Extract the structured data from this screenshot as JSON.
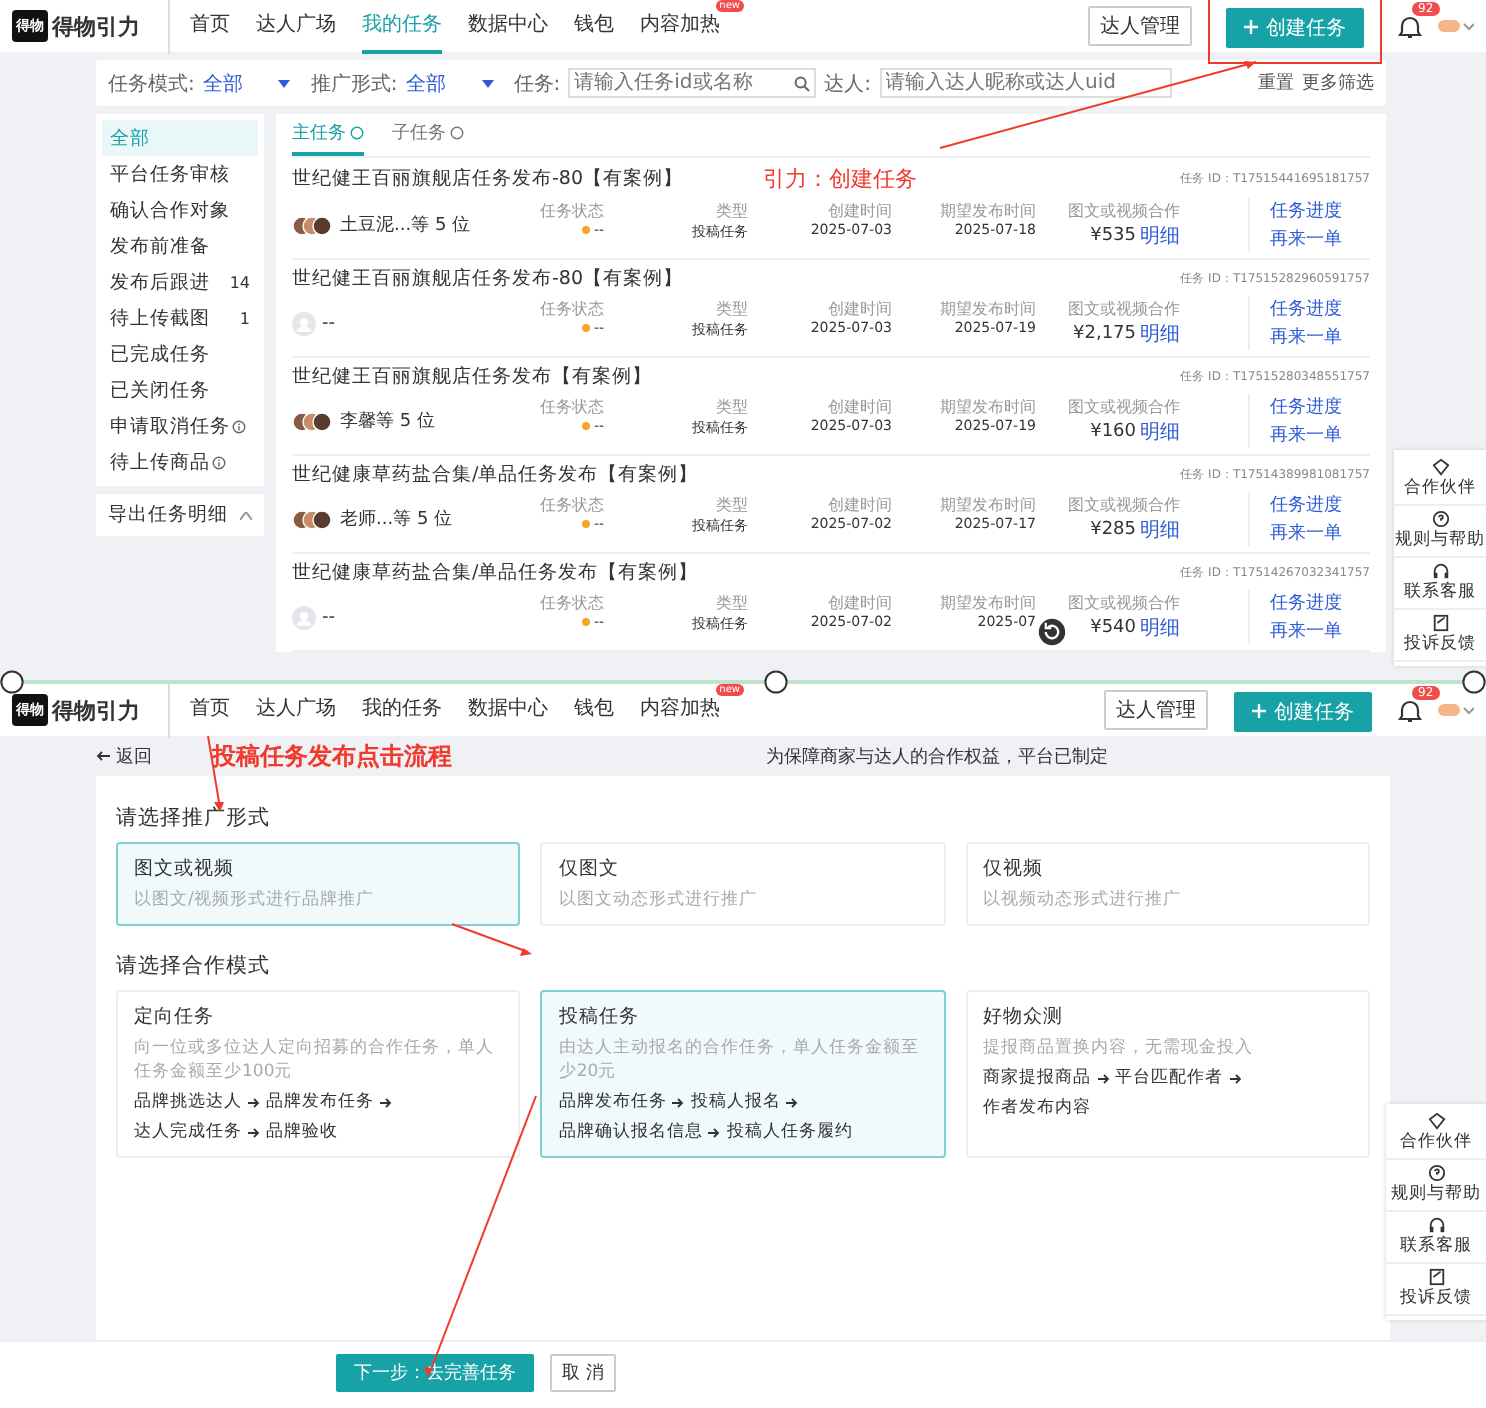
{
  "top": {
    "nav": {
      "logo_mark": "得物",
      "logo_text": "得物引力",
      "items": [
        {
          "label": "首页",
          "selected": false
        },
        {
          "label": "达人广场",
          "selected": false
        },
        {
          "label": "我的任务",
          "selected": true
        },
        {
          "label": "数据中心",
          "selected": false
        },
        {
          "label": "钱包",
          "selected": false
        },
        {
          "label": "内容加热",
          "selected": false,
          "badge": "new"
        }
      ],
      "manage": "达人管理",
      "create": "创建任务",
      "highlighted": true,
      "notifications": "92"
    },
    "filters": {
      "mode_label": "任务模式:",
      "mode_value": "全部",
      "form_label": "推广形式:",
      "form_value": "全部",
      "task_label": "任务:",
      "task_placeholder": "请输入任务id或名称",
      "talent_label": "达人:",
      "talent_placeholder": "请输入达人昵称或达人uid",
      "reset": "重置",
      "more": "更多筛选"
    },
    "sidebar": {
      "items": [
        {
          "label": "全部",
          "selected": true
        },
        {
          "label": "平台任务审核",
          "selected": false
        },
        {
          "label": "确认合作对象",
          "selected": false
        },
        {
          "label": "发布前准备",
          "selected": false
        },
        {
          "label": "发布后跟进",
          "selected": false,
          "count": "14"
        },
        {
          "label": "待上传截图",
          "selected": false,
          "count": "1"
        },
        {
          "label": "已完成任务",
          "selected": false
        },
        {
          "label": "已关闭任务",
          "selected": false
        },
        {
          "label": "申请取消任务",
          "selected": false,
          "info": true
        },
        {
          "label": "待上传商品",
          "selected": false,
          "info": true
        }
      ],
      "export": "导出任务明细"
    },
    "tabs": [
      {
        "label": "主任务",
        "selected": true
      },
      {
        "label": "子任务",
        "selected": false
      }
    ],
    "annotation": "引力：创建任务",
    "tasks": [
      {
        "title": "世纪健王百丽旗舰店任务发布-80【有案例】",
        "talents": "土豆泥...等 5 位",
        "avatars": true,
        "id": "任务 ID：T17515441695181757",
        "fields": [
          {
            "kind": "status",
            "label": "任务状态",
            "value": "--"
          },
          {
            "kind": "text",
            "label": "类型",
            "value": "投稿任务"
          },
          {
            "kind": "text",
            "label": "创建时间",
            "value": "2025-07-03"
          },
          {
            "kind": "text",
            "label": "期望发布时间",
            "value": "2025-07-18"
          },
          {
            "kind": "price",
            "label": "图文或视频合作",
            "value": "¥535",
            "link": "明细"
          }
        ],
        "actions": [
          "任务进度",
          "再来一单"
        ]
      },
      {
        "title": "世纪健王百丽旗舰店任务发布-80【有案例】",
        "talents": "--",
        "avatars": false,
        "id": "任务 ID：T17515282960591757",
        "fields": [
          {
            "kind": "status",
            "label": "任务状态",
            "value": "--"
          },
          {
            "kind": "text",
            "label": "类型",
            "value": "投稿任务"
          },
          {
            "kind": "text",
            "label": "创建时间",
            "value": "2025-07-03"
          },
          {
            "kind": "text",
            "label": "期望发布时间",
            "value": "2025-07-19"
          },
          {
            "kind": "price",
            "label": "图文或视频合作",
            "value": "¥2,175",
            "link": "明细"
          }
        ],
        "actions": [
          "任务进度",
          "再来一单"
        ]
      },
      {
        "title": "世纪健王百丽旗舰店任务发布【有案例】",
        "talents": "李馨等 5 位",
        "avatars": true,
        "id": "任务 ID：T17515280348551757",
        "fields": [
          {
            "kind": "status",
            "label": "任务状态",
            "value": "--"
          },
          {
            "kind": "text",
            "label": "类型",
            "value": "投稿任务"
          },
          {
            "kind": "text",
            "label": "创建时间",
            "value": "2025-07-03"
          },
          {
            "kind": "text",
            "label": "期望发布时间",
            "value": "2025-07-19"
          },
          {
            "kind": "price",
            "label": "图文或视频合作",
            "value": "¥160",
            "link": "明细"
          }
        ],
        "actions": [
          "任务进度",
          "再来一单"
        ]
      },
      {
        "title": "世纪健康草药盐合集/单品任务发布【有案例】",
        "talents": "老师...等 5 位",
        "avatars": true,
        "id": "任务 ID：T17514389981081757",
        "fields": [
          {
            "kind": "status",
            "label": "任务状态",
            "value": "--"
          },
          {
            "kind": "text",
            "label": "类型",
            "value": "投稿任务"
          },
          {
            "kind": "text",
            "label": "创建时间",
            "value": "2025-07-02"
          },
          {
            "kind": "text",
            "label": "期望发布时间",
            "value": "2025-07-17"
          },
          {
            "kind": "price",
            "label": "图文或视频合作",
            "value": "¥285",
            "link": "明细"
          }
        ],
        "actions": [
          "任务进度",
          "再来一单"
        ]
      },
      {
        "title": "世纪健康草药盐合集/单品任务发布【有案例】",
        "talents": "--",
        "avatars": false,
        "id": "任务 ID：T17514267032341757",
        "fields": [
          {
            "kind": "status",
            "label": "任务状态",
            "value": "--"
          },
          {
            "kind": "text",
            "label": "类型",
            "value": "投稿任务"
          },
          {
            "kind": "text",
            "label": "创建时间",
            "value": "2025-07-02"
          },
          {
            "kind": "text",
            "label": "期望发布时间",
            "value": "2025-07"
          },
          {
            "kind": "price",
            "label": "图文或视频合作",
            "value": "¥540",
            "link": "明细"
          }
        ],
        "actions": [
          "任务进度",
          "再来一单"
        ]
      }
    ],
    "side_tools": [
      "合作伙伴",
      "规则与帮助",
      "联系客服",
      "投诉反馈"
    ]
  },
  "bottom": {
    "nav": {
      "logo_mark": "得物",
      "logo_text": "得物引力",
      "items": [
        {
          "label": "首页",
          "selected": false
        },
        {
          "label": "达人广场",
          "selected": false
        },
        {
          "label": "我的任务",
          "selected": false
        },
        {
          "label": "数据中心",
          "selected": false
        },
        {
          "label": "钱包",
          "selected": false
        },
        {
          "label": "内容加热",
          "selected": false,
          "badge": "new"
        }
      ],
      "manage": "达人管理",
      "create": "创建任务",
      "highlighted": false,
      "notifications": "92"
    },
    "back": "返回",
    "annotation": "投稿任务发布点击流程",
    "notice": "为保障商家与达人的合作权益，平台已制定",
    "promo_title": "请选择推广形式",
    "promo_options": [
      {
        "title": "图文或视频",
        "desc": "以图文/视频形式进行品牌推广",
        "selected": true
      },
      {
        "title": "仅图文",
        "desc": "以图文动态形式进行推广",
        "selected": false
      },
      {
        "title": "仅视频",
        "desc": "以视频动态形式进行推广",
        "selected": false
      }
    ],
    "mode_title": "请选择合作模式",
    "modes": [
      {
        "title": "定向任务",
        "desc": "向一位或多位达人定向招募的合作任务，单人任务金额至少100元",
        "steps": [
          "品牌挑选达人",
          "品牌发布任务",
          "达人完成任务",
          "品牌验收"
        ],
        "selected": false
      },
      {
        "title": "投稿任务",
        "desc": "由达人主动报名的合作任务，单人任务金额至少20元",
        "steps": [
          "品牌发布任务",
          "投稿人报名",
          "品牌确认报名信息",
          "投稿人任务履约"
        ],
        "selected": true
      },
      {
        "title": "好物众测",
        "desc": "提报商品置换内容，无需现金投入",
        "steps": [
          "商家提报商品",
          "平台匹配作者",
          "作者发布内容"
        ],
        "selected": false
      }
    ],
    "side_tools": [
      "合作伙伴",
      "规则与帮助",
      "联系客服",
      "投诉反馈"
    ],
    "next": "下一步：去完善任务",
    "cancel": "取 消"
  }
}
